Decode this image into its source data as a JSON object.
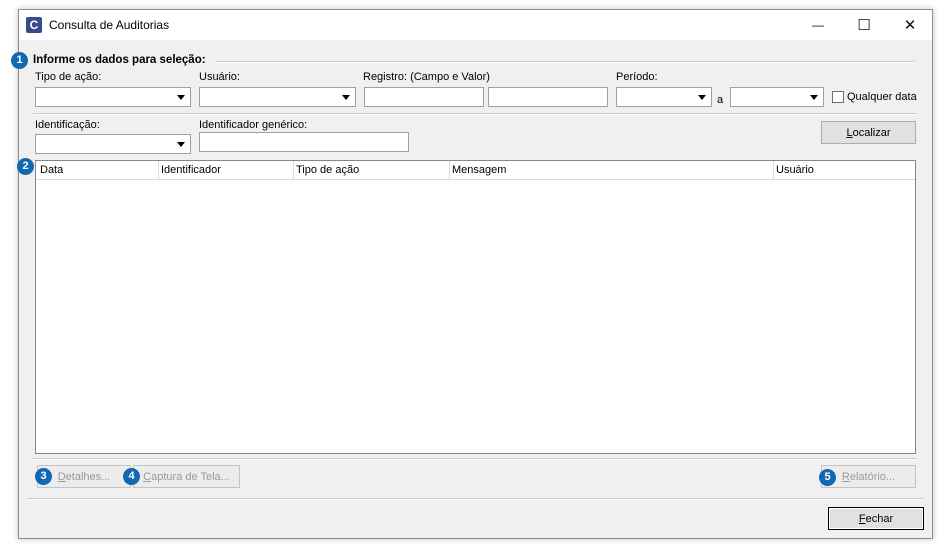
{
  "window": {
    "title": "Consulta de Auditorias",
    "app_icon_letter": "C",
    "controls": {
      "minimize": "—",
      "maximize": "☐",
      "close": "✕"
    }
  },
  "badges": [
    "1",
    "2",
    "3",
    "4",
    "5"
  ],
  "selection": {
    "group_title": "Informe os dados para seleção:",
    "tipo_acao_label": "Tipo de ação:",
    "usuario_label": "Usuário:",
    "registro_label": "Registro: (Campo e Valor)",
    "periodo_label": "Período:",
    "periodo_sep": "a",
    "qualquer_data_label": "Qualquer data",
    "identificacao_label": "Identificação:",
    "identificador_generico_label": "Identificador genérico:",
    "localizar_button": "Localizar",
    "localizar_accel": "L",
    "localizar_rest": "ocalizar"
  },
  "grid": {
    "columns": [
      "Data",
      "Identificador",
      "Tipo de ação",
      "Mensagem",
      "Usuário"
    ]
  },
  "actions": {
    "detalhes_accel": "D",
    "detalhes_rest": "etalhes...",
    "captura_accel": "C",
    "captura_rest": "aptura de Tela...",
    "relatorio_accel": "R",
    "relatorio_rest": "elatório...",
    "fechar_accel": "F",
    "fechar_rest": "echar"
  }
}
